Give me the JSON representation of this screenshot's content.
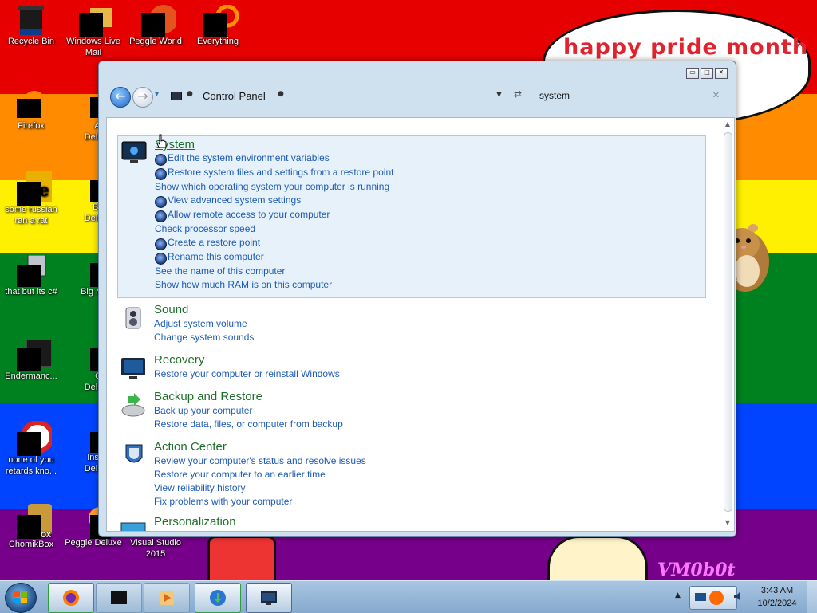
{
  "desktop": {
    "bubble_text": "happy pride month",
    "watermark": "VM0b0t",
    "icons": [
      {
        "label": "Recycle Bin"
      },
      {
        "label": "Windows Live Mail"
      },
      {
        "label": "Peggle World"
      },
      {
        "label": "Everything"
      },
      {
        "label": "Firefox"
      },
      {
        "label": "Astro Delu"
      },
      {
        "label": "some russian ran a rat"
      },
      {
        "label": "Bejew Delu"
      },
      {
        "label": "that but its c#"
      },
      {
        "label": "Big M Delu"
      },
      {
        "label": "Endermanc..."
      },
      {
        "label": "Chuz Delu"
      },
      {
        "label": "none of you retards kno..."
      },
      {
        "label": "Insaniq Delu"
      },
      {
        "label": "ChomikBox"
      },
      {
        "label": "Peggle Deluxe"
      },
      {
        "label": "Visual Studio 2015"
      }
    ]
  },
  "window": {
    "breadcrumb": "Control Panel",
    "search_value": "system",
    "caption": {
      "minimize": "▭",
      "maximize": "□",
      "close": "✕"
    }
  },
  "results": [
    {
      "title": "System",
      "selected": true,
      "links": [
        {
          "text": "Edit the system environment variables",
          "shield": true
        },
        {
          "text": "Restore system files and settings from a restore point",
          "shield": true
        },
        {
          "text": "Show which operating system your computer is running",
          "shield": false
        },
        {
          "text": "View advanced system settings",
          "shield": true
        },
        {
          "text": "Allow remote access to your computer",
          "shield": true
        },
        {
          "text": "Check processor speed",
          "shield": false
        },
        {
          "text": "Create a restore point",
          "shield": true
        },
        {
          "text": "Rename this computer",
          "shield": true
        },
        {
          "text": "See the name of this computer",
          "shield": false
        },
        {
          "text": "Show how much RAM is on this computer",
          "shield": false
        }
      ]
    },
    {
      "title": "Sound",
      "links": [
        {
          "text": "Adjust system volume",
          "shield": false
        },
        {
          "text": "Change system sounds",
          "shield": false
        }
      ]
    },
    {
      "title": "Recovery",
      "links": [
        {
          "text": "Restore your computer or reinstall Windows",
          "shield": false
        }
      ]
    },
    {
      "title": "Backup and Restore",
      "links": [
        {
          "text": "Back up your computer",
          "shield": false
        },
        {
          "text": "Restore data, files, or computer from backup",
          "shield": false
        }
      ]
    },
    {
      "title": "Action Center",
      "links": [
        {
          "text": "Review your computer's status and resolve issues",
          "shield": false
        },
        {
          "text": "Restore your computer to an earlier time",
          "shield": false
        },
        {
          "text": "View reliability history",
          "shield": false
        },
        {
          "text": "Fix problems with your computer",
          "shield": false
        }
      ]
    },
    {
      "title": "Personalization",
      "links": []
    }
  ],
  "taskbar": {
    "time": "3:43 AM",
    "date": "10/2/2024",
    "buttons": [
      "firefox",
      "black-box-app",
      "media-player",
      "download-manager",
      "control-panel"
    ]
  },
  "colors": {
    "link_blue": "#1e5bb5",
    "title_green": "#1e6f2a",
    "selection_bg": "#e6f1f9"
  }
}
